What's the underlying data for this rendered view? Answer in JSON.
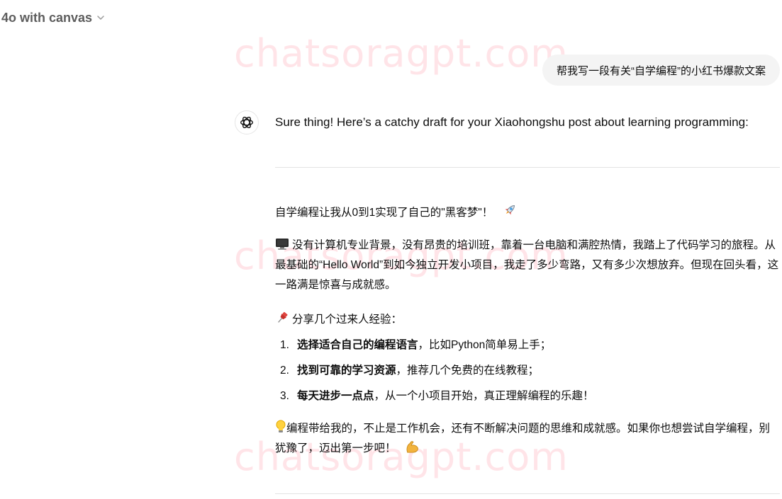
{
  "header": {
    "model_label": "4o with canvas"
  },
  "watermark": {
    "text": "chatsoragpt.com"
  },
  "conversation": {
    "user_message": "帮我写一段有关“自学编程”的小红书爆款文案",
    "assistant_intro": "Sure thing! Here’s a catchy draft for your Xiaohongshu post about learning programming:",
    "post": {
      "headline": "自学编程让我从0到1实现了自己的\"黑客梦\"！",
      "headline_emoji": "rocket-icon",
      "story_emoji": "computer-icon",
      "story": "没有计算机专业背景，没有昂贵的培训班，靠着一台电脑和满腔热情，我踏上了代码学习的旅程。从最基础的“Hello World”到如今独立开发小项目，我走了多少弯路，又有多少次想放弃。但现在回头看，这一路满是惊喜与成就感。",
      "tips_emoji": "pushpin-icon",
      "tips_heading": "分享几个过来人经验：",
      "tips": [
        {
          "num": "1.",
          "bold": "选择适合自己的编程语言",
          "rest": "，比如Python简单易上手；"
        },
        {
          "num": "2.",
          "bold": "找到可靠的学习资源",
          "rest": "，推荐几个免费的在线教程；"
        },
        {
          "num": "3.",
          "bold": "每天进步一点点",
          "rest": "，从一个小项目开始，真正理解编程的乐趣！"
        }
      ],
      "closing_emoji": "lightbulb-icon",
      "closing": "编程带给我的，不止是工作机会，还有不断解决问题的思维和成就感。如果你也想尝试自学编程，别犹豫了，迈出第一步吧！",
      "closing_end_emoji": "flexed-biceps-icon"
    }
  },
  "colors": {
    "bubble_bg": "#f4f4f4",
    "text": "#0d0d0d",
    "muted": "#5d5d5d",
    "divider": "#e3e3e3",
    "watermark": "#ff5a6e"
  }
}
